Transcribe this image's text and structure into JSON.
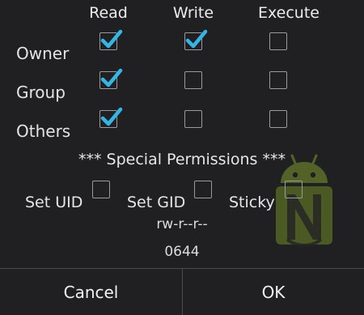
{
  "columns": {
    "read": "Read",
    "write": "Write",
    "execute": "Execute"
  },
  "rows": [
    {
      "label": "Owner",
      "read": true,
      "write": true,
      "execute": false
    },
    {
      "label": "Group",
      "read": true,
      "write": false,
      "execute": false
    },
    {
      "label": "Others",
      "read": true,
      "write": false,
      "execute": false
    }
  ],
  "special": {
    "title": "*** Special Permissions ***",
    "set_uid": {
      "label": "Set UID",
      "checked": false
    },
    "set_gid": {
      "label": "Set GID",
      "checked": false
    },
    "sticky": {
      "label": "Sticky",
      "checked": false
    }
  },
  "mode": {
    "symbolic": "rw-r--r--",
    "octal": "0644"
  },
  "buttons": {
    "cancel": "Cancel",
    "ok": "OK"
  },
  "colors": {
    "check": "#33b5e5",
    "background": "#202022"
  }
}
